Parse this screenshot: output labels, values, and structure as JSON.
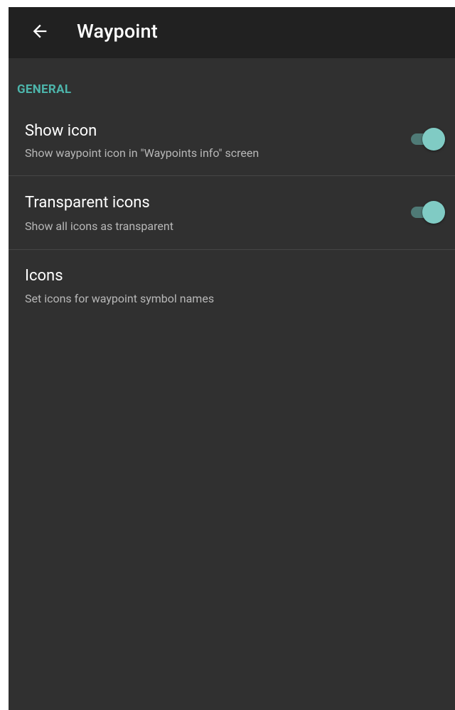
{
  "appbar": {
    "title": "Waypoint",
    "back_icon": "arrow-back-icon"
  },
  "colors": {
    "background": "#303030",
    "appbar": "#212121",
    "accent": "#4db6ac",
    "switch_thumb": "#80cbc4",
    "switch_track": "#4f7a76"
  },
  "section": {
    "header": "GENERAL"
  },
  "preferences": [
    {
      "title": "Show icon",
      "summary": "Show waypoint icon in \"Waypoints info\" screen",
      "switch_on": true
    },
    {
      "title": "Transparent icons",
      "summary": "Show all icons as transparent",
      "switch_on": true
    },
    {
      "title": "Icons",
      "summary": "Set icons for waypoint symbol names"
    }
  ]
}
